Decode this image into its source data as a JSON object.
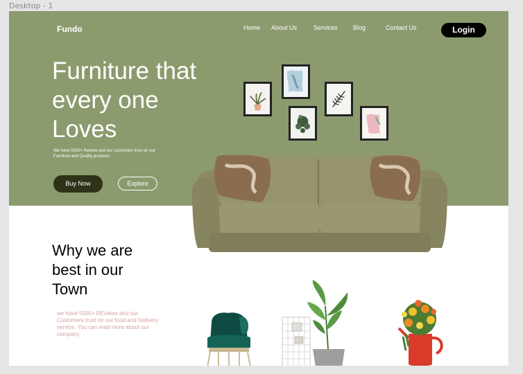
{
  "frame_label": "Desktop - 1",
  "brand": "Fundo",
  "nav": {
    "home": "Home",
    "about": "About Us",
    "services": "Services",
    "blog": "Blog",
    "contact": "Contact  Us"
  },
  "login_label": "Login",
  "hero": {
    "title_lines": [
      "Furniture that",
      "every one",
      "Loves"
    ],
    "subtitle": "We have 5000+ Review and our customers trust on our Furniture and Quality products",
    "buy_label": "Buy Now",
    "explore_label": "Explore"
  },
  "why": {
    "title_lines": [
      "Why we are",
      "best in our",
      "Town"
    ],
    "text": "we have 5000+  REviews and our Customers trust on our food and Delivery service. You can read more about our company."
  },
  "colors": {
    "hero_bg": "#8b9b6e",
    "dark_button": "#2e3218",
    "body_text": "#d3a3a0",
    "canvas_bg": "#e5e5e5"
  }
}
